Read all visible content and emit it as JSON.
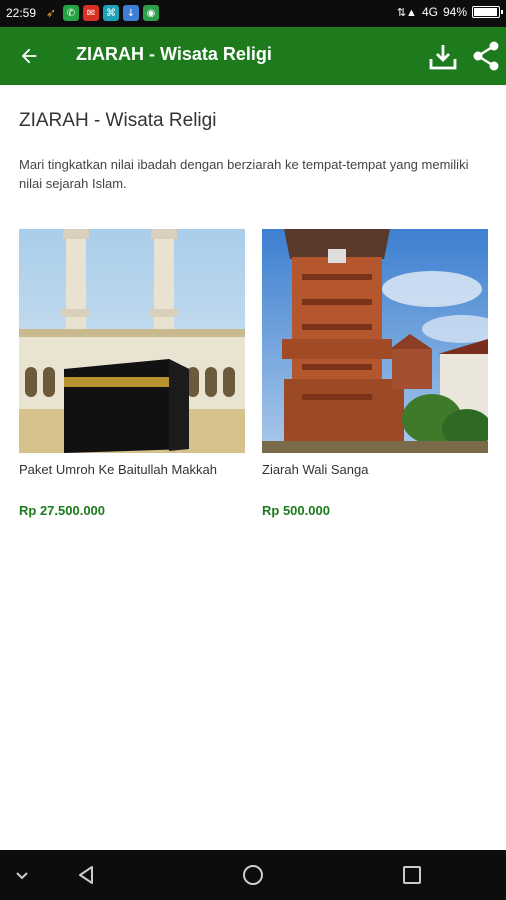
{
  "status_bar": {
    "time": "22:59",
    "network": "4G",
    "battery": "94%",
    "battery_level": 0.94
  },
  "app_bar": {
    "title": "ZIARAH - Wisata Religi",
    "back_icon": "arrow-left-icon",
    "download_icon": "download-icon",
    "share_icon": "share-icon",
    "color": "#1d7a1d"
  },
  "page": {
    "title": "ZIARAH - Wisata Religi",
    "description": "Mari tingkatkan nilai ibadah dengan berziarah ke tempat-tempat yang memiliki nilai sejarah Islam."
  },
  "products": [
    {
      "name": "Paket Umroh Ke Baitullah Makkah",
      "price": "Rp 27.500.000",
      "image": "kaaba-photo"
    },
    {
      "name": "Ziarah Wali Sanga",
      "price": "Rp 500.000",
      "image": "kudus-minaret-photo"
    }
  ],
  "nav_bar": {
    "icons": [
      "chevron-down-icon",
      "back-triangle-icon",
      "home-circle-icon",
      "recents-square-icon"
    ]
  }
}
